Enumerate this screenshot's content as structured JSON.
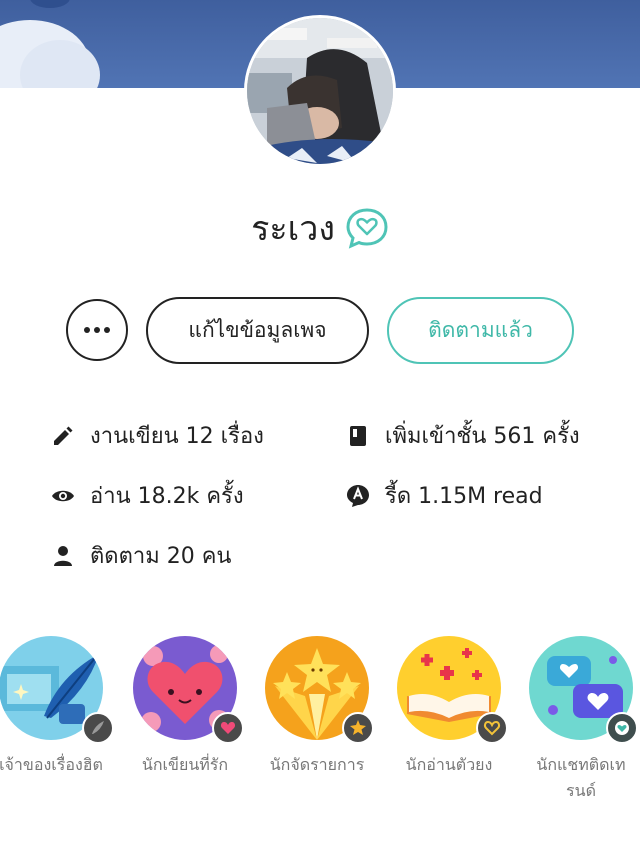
{
  "profile": {
    "name": "ระเวง"
  },
  "actions": {
    "more_label": "more",
    "edit_label": "แก้ไขข้อมูลเพจ",
    "follow_label": "ติดตามแล้ว"
  },
  "stats": {
    "works": "งานเขียน 12 เรื่อง",
    "shelf": "เพิ่มเข้าชั้น 561 ครั้ง",
    "reads": "อ่าน 18.2k ครั้ง",
    "chat_reads": "รี้ด 1.15M read",
    "following": "ติดตาม 20 คน"
  },
  "badges": [
    {
      "label": "เจ้าของเรื่องฮิต",
      "icon": "feather-icon"
    },
    {
      "label": "นักเขียนที่รัก",
      "icon": "heart-icon"
    },
    {
      "label": "นักจัดรายการ",
      "icon": "star-icon"
    },
    {
      "label": "นักอ่านตัวยง",
      "icon": "book-icon"
    },
    {
      "label": "นักแชทติดเทรนด์",
      "icon": "chat-heart-icon"
    }
  ],
  "colors": {
    "accent": "#4fc4b6",
    "cover": "#4a6aab"
  }
}
